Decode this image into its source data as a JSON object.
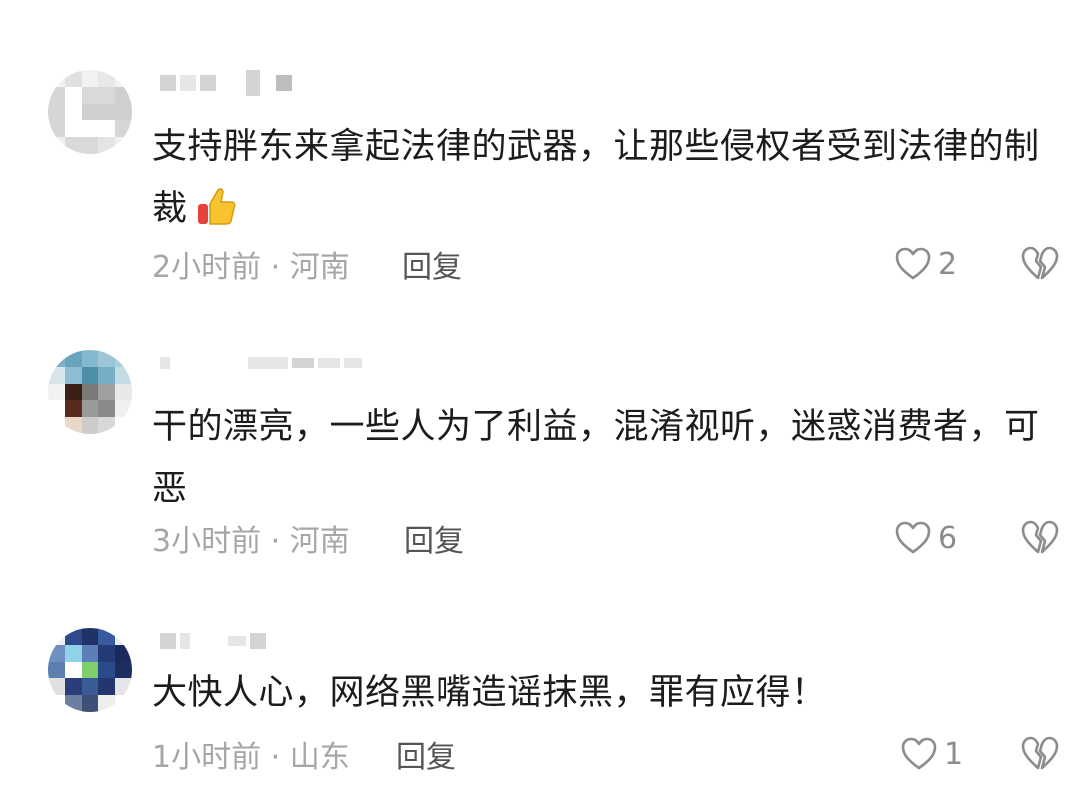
{
  "comments": [
    {
      "text": "支持胖东来拿起法律的武器，让那些侵权者受到法律的制裁",
      "time_location": "2小时前 · 河南",
      "reply_label": "回复",
      "like_count": "2",
      "avatar_colors": [
        "#cfcfcf",
        "#e2e2e2",
        "#f0f0f0"
      ]
    },
    {
      "text": "干的漂亮，一些人为了利益，混淆视听，迷惑消费者，可恶",
      "time_location": "3小时前 · 河南",
      "reply_label": "回复",
      "like_count": "6",
      "avatar_colors": [
        "#7fb2c9",
        "#3b1f16",
        "#8a8a8a"
      ]
    },
    {
      "text": "大快人心，网络黑嘴造谣抹黑，罪有应得！",
      "time_location": "1小时前 · 山东",
      "reply_label": "回复",
      "like_count": "1",
      "avatar_colors": [
        "#2f4a8a",
        "#8fd3e8",
        "#7ecf6a"
      ]
    }
  ],
  "icons": {
    "like": "heart-outline-icon",
    "dislike": "broken-heart-icon",
    "emoji": "thumbs-up-emoji"
  },
  "colors": {
    "text": "#1c1c1c",
    "meta": "#a6a6a6",
    "reply": "#555555",
    "icon": "#8c8c8c"
  }
}
